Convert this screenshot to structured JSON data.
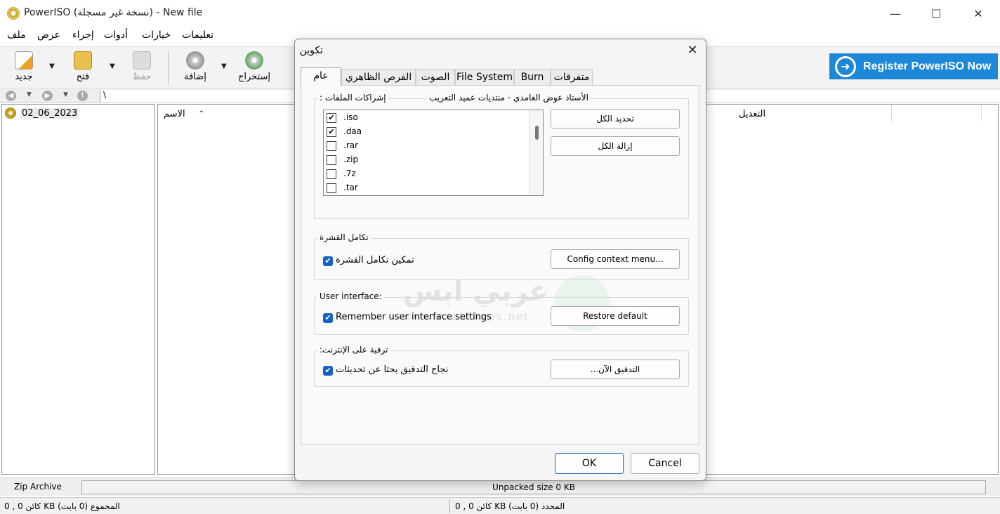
{
  "window": {
    "title": "PowerISO (نسخة غير مسجلة) - New file",
    "minimize": "—",
    "maximize": "☐",
    "close": "✕"
  },
  "menu": {
    "file": "ملف",
    "view": "عرض",
    "action": "إجراء",
    "tools": "أدوات",
    "options": "خيارات",
    "help": "تعليمات"
  },
  "toolbar": {
    "new": "جديد",
    "open": "فتح",
    "save": "حفظ",
    "add": "إضافة",
    "extract": "إستخراج",
    "register": "Register PowerISO Now"
  },
  "nav": {
    "path": "\\"
  },
  "tree": {
    "item": "02_06_2023"
  },
  "columns": {
    "name": "الاسم",
    "modified": "التعديل",
    "sort_mark": "^"
  },
  "status": {
    "archive_type": "Zip Archive",
    "unpacked": "Unpacked size 0 KB",
    "progress_fraction": 0,
    "total": "0 , كائن 0 KB المجموع (0 بايت)",
    "selected": "0 , كائن 0 KB المحدد (0 بايت)"
  },
  "dialog": {
    "title": "تكوين",
    "tabs": [
      "عام",
      "الفرص الظاهري",
      "الصوت",
      "File System",
      "Burn",
      "متفرقات"
    ],
    "associations": {
      "title": ": إشراكات الملفات",
      "author": "الأستاذ عوض الغامدي - منتديات عميد التعريب",
      "items": [
        {
          "ext": ".iso",
          "checked": "✔"
        },
        {
          "ext": ".daa",
          "checked": "✔"
        },
        {
          "ext": ".rar",
          "checked": ""
        },
        {
          "ext": ".zip",
          "checked": ""
        },
        {
          "ext": ".7z",
          "checked": ""
        },
        {
          "ext": ".tar",
          "checked": ""
        }
      ],
      "select_all": "تحديد الكل",
      "clear_all": "إزالة الكل"
    },
    "shell": {
      "title": "تكامل القشرة",
      "enable_label": "تمكين تكامل القشرة",
      "enable_checked": "✔",
      "config_button": "Config context menu..."
    },
    "ui": {
      "title": "User interface:",
      "remember_label": "Remember user interface settings",
      "remember_checked": "✔",
      "restore_button": "Restore default"
    },
    "upgrade": {
      "title": ":ترقية على الإنترنت",
      "check_label": "نجاح التدقيق بحثا عن تحديثات",
      "check_checked": "✔",
      "check_now_button": "...التدقيق الآن"
    },
    "watermark": {
      "arabic": "عربي ابس",
      "url": "www.ArabiApps.net"
    },
    "ok": "OK",
    "cancel": "Cancel"
  },
  "colors": {
    "register_bg": "#1e88d8",
    "accent": "#1565c0"
  }
}
